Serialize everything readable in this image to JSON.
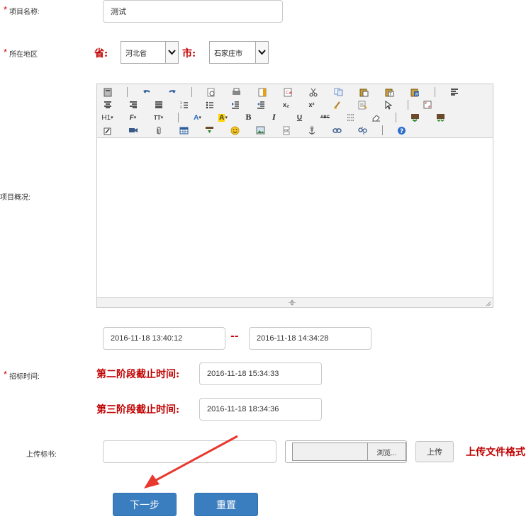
{
  "form": {
    "project_name": {
      "label": "项目名称:",
      "value": "测试"
    },
    "region": {
      "label": "所在地区",
      "province_label": "省:",
      "province_value": "河北省",
      "city_label": "市:",
      "city_value": "石家庄市"
    },
    "overview": {
      "label": "项目概况:"
    },
    "bid_time": {
      "label": "招标时间:",
      "start": "2016-11-18 13:40:12",
      "separator": "--",
      "end": "2016-11-18 14:34:28",
      "stage2_label": "第二阶段截止时间:",
      "stage2_value": "2016-11-18 15:34:33",
      "stage3_label": "第三阶段截止时间:",
      "stage3_value": "2016-11-18 18:34:36"
    },
    "upload": {
      "label": "上传标书:",
      "text_value": "",
      "browse_label": "浏览...",
      "upload_label": "上传",
      "format_note": "上传文件格式"
    },
    "buttons": {
      "next": "下一步",
      "reset": "重置"
    },
    "required_mark": "*"
  },
  "editor": {
    "toolbar_rows": [
      [
        "source-icon",
        "|",
        "undo-icon",
        "redo-icon",
        "|",
        "preview-icon",
        "print-icon",
        "template-icon",
        "code-icon",
        "cut-icon",
        "copy-icon",
        "paste-icon",
        "paste-text-icon",
        "paste-word-icon",
        "|",
        "align-left-icon"
      ],
      [
        "align-center-icon",
        "align-right-icon",
        "align-justify-icon",
        "ordered-list-icon",
        "unordered-list-icon",
        "indent-icon",
        "outdent-icon",
        "subscript-icon",
        "superscript-icon",
        "clear-format-icon",
        "select-all-icon",
        "|",
        "fullscreen-icon"
      ],
      [
        "heading-icon",
        "font-family-icon",
        "font-size-icon",
        "|",
        "font-color-icon",
        "highlight-icon",
        "bold-icon",
        "italic-icon",
        "underline-icon",
        "strikethrough-icon",
        "line-height-icon",
        "eraser-icon",
        "|",
        "image-upload-icon",
        "multi-image-icon"
      ],
      [
        "flash-icon",
        "media-icon",
        "attachment-icon",
        "table-icon",
        "hr-icon",
        "emoticon-icon",
        "image-icon",
        "pagebreak-icon",
        "anchor-icon",
        "link-icon",
        "unlink-icon",
        "|",
        "help-icon"
      ]
    ],
    "toolbar_text": {
      "heading": "H1",
      "font_family": "F",
      "font_size": "TT",
      "font_color": "A",
      "highlight": "A",
      "bold": "B",
      "italic": "I",
      "underline": "U",
      "strike": "ABC",
      "sub": "x₂",
      "sup": "x²"
    }
  },
  "colors": {
    "required": "#d40000",
    "emphasis": "#c00000",
    "primary_button": "#3b7ec0",
    "arrow": "#e8382f"
  }
}
